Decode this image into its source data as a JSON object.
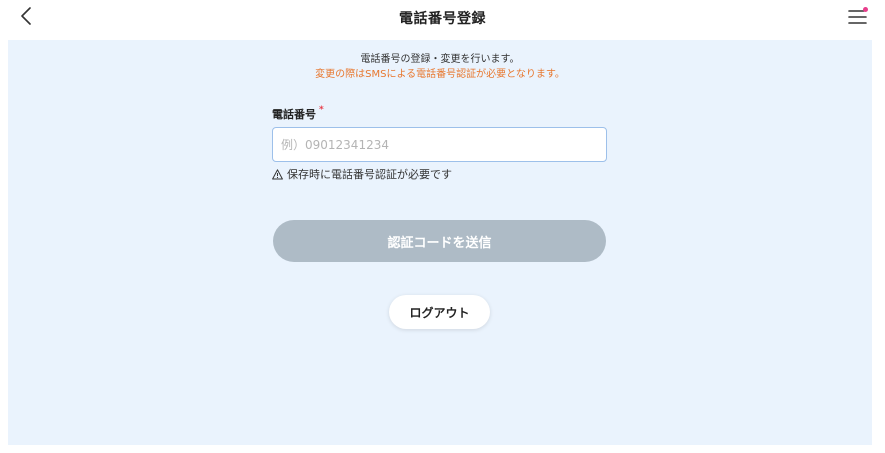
{
  "header": {
    "title": "電話番号登録",
    "back_icon": "chevron-left-icon",
    "menu_icon": "hamburger-menu-icon",
    "notification_dot_color": "#e83e8c"
  },
  "intro": {
    "line1": "電話番号の登録・変更を行います。",
    "line2": "変更の際はSMSによる電話番号認証が必要となります。",
    "line2_color": "#e8772e"
  },
  "form": {
    "phone_label": "電話番号",
    "required_mark": "*",
    "phone_value": "",
    "phone_placeholder": "例）09012341234",
    "hint_icon": "warning-icon",
    "hint_text": "保存時に電話番号認証が必要です"
  },
  "actions": {
    "send_code_label": "認証コードを送信",
    "send_code_color": "#aebbc6",
    "logout_label": "ログアウト"
  },
  "colors": {
    "background": "#eaf3fd",
    "input_border": "#9dc0ea",
    "required": "#e83e4a"
  }
}
